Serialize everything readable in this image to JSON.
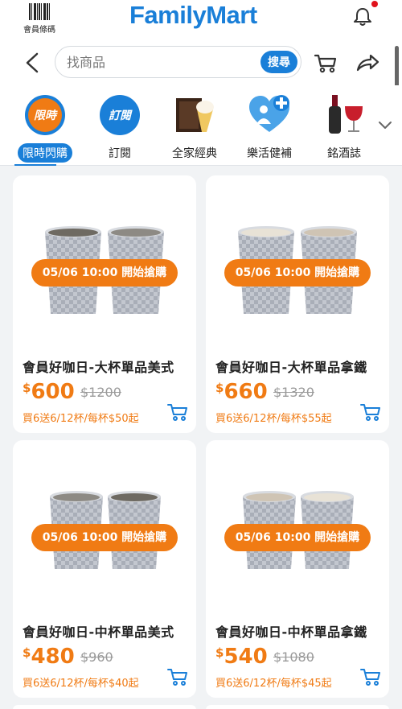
{
  "header": {
    "member_code_label": "會員條碼",
    "brand": "FamilyMart"
  },
  "search": {
    "placeholder": "找商品",
    "button_label": "搜尋"
  },
  "categories": [
    {
      "label": "限時閃購",
      "icon": "limited-time-icon",
      "icon_text": "限時",
      "active": true
    },
    {
      "label": "訂閱",
      "icon": "subscription-icon",
      "icon_text": "訂閱",
      "active": false
    },
    {
      "label": "全家經典",
      "icon": "classic-coffee-icon",
      "active": false
    },
    {
      "label": "樂活健補",
      "icon": "health-icon",
      "active": false
    },
    {
      "label": "銘酒誌",
      "icon": "wine-icon",
      "active": false
    }
  ],
  "products": [
    {
      "badge": "05/06 10:00 開始搶購",
      "name": "會員好咖日-大杯單品美式",
      "currency": "$",
      "price": "600",
      "old_price": "$1200",
      "promo": "買6送6/12杯/每杯$50起"
    },
    {
      "badge": "05/06 10:00 開始搶購",
      "name": "會員好咖日-大杯單品拿鐵",
      "currency": "$",
      "price": "660",
      "old_price": "$1320",
      "promo": "買6送6/12杯/每杯$55起"
    },
    {
      "badge": "05/06 10:00 開始搶購",
      "name": "會員好咖日-中杯單品美式",
      "currency": "$",
      "price": "480",
      "old_price": "$960",
      "promo": "買6送6/12杯/每杯$40起"
    },
    {
      "badge": "05/06 10:00 開始搶購",
      "name": "會員好咖日-中杯單品拿鐵",
      "currency": "$",
      "price": "540",
      "old_price": "$1080",
      "promo": "買6送6/12杯/每杯$45起"
    }
  ],
  "colors": {
    "brand_blue": "#1a7fd8",
    "accent_orange": "#f07b14",
    "notification_red": "#e0121c"
  }
}
